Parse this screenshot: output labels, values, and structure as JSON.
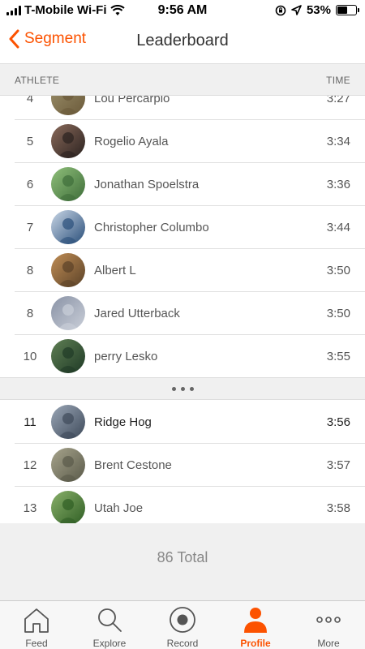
{
  "status_bar": {
    "carrier": "T-Mobile Wi-Fi",
    "time": "9:56 AM",
    "battery": "53%",
    "battery_level": 0.53
  },
  "nav": {
    "back_label": "Segment",
    "title": "Leaderboard"
  },
  "columns": {
    "athlete": "ATHLETE",
    "time": "TIME"
  },
  "rows_top": [
    {
      "rank": "4",
      "name": "Lou Percarpio",
      "time": "3:27",
      "colors": [
        "#6b5a3a",
        "#9b8f6a"
      ]
    },
    {
      "rank": "5",
      "name": "Rogelio Ayala",
      "time": "3:34",
      "colors": [
        "#2b2220",
        "#8a6a5a"
      ]
    },
    {
      "rank": "6",
      "name": "Jonathan Spoelstra",
      "time": "3:36",
      "colors": [
        "#3f6e3a",
        "#8fbf7a"
      ]
    },
    {
      "rank": "7",
      "name": "Christopher Columbo",
      "time": "3:44",
      "colors": [
        "#2a4f7a",
        "#c9d6e6"
      ]
    },
    {
      "rank": "8",
      "name": "Albert L",
      "time": "3:50",
      "colors": [
        "#5b4228",
        "#c08d55"
      ]
    },
    {
      "rank": "8",
      "name": "Jared Utterback",
      "time": "3:50",
      "colors": [
        "#c9ced8",
        "#8a93a6"
      ]
    },
    {
      "rank": "10",
      "name": "perry Lesko",
      "time": "3:55",
      "colors": [
        "#1f3a26",
        "#5f7f54"
      ]
    }
  ],
  "rows_bottom": [
    {
      "rank": "11",
      "name": "Ridge Hog",
      "time": "3:56",
      "colors": [
        "#3e4a5a",
        "#9aa6b6"
      ],
      "highlight": true
    },
    {
      "rank": "12",
      "name": "Brent Cestone",
      "time": "3:57",
      "colors": [
        "#5a5a4a",
        "#a7a48c"
      ]
    },
    {
      "rank": "13",
      "name": "Utah Joe",
      "time": "3:58",
      "colors": [
        "#2f5e24",
        "#89b06a"
      ]
    }
  ],
  "total": "86 Total",
  "tabs": [
    {
      "label": "Feed",
      "icon": "home-icon"
    },
    {
      "label": "Explore",
      "icon": "search-icon"
    },
    {
      "label": "Record",
      "icon": "record-icon"
    },
    {
      "label": "Profile",
      "icon": "profile-icon",
      "active": true
    },
    {
      "label": "More",
      "icon": "more-icon"
    }
  ],
  "colors": {
    "accent": "#fc5200"
  }
}
